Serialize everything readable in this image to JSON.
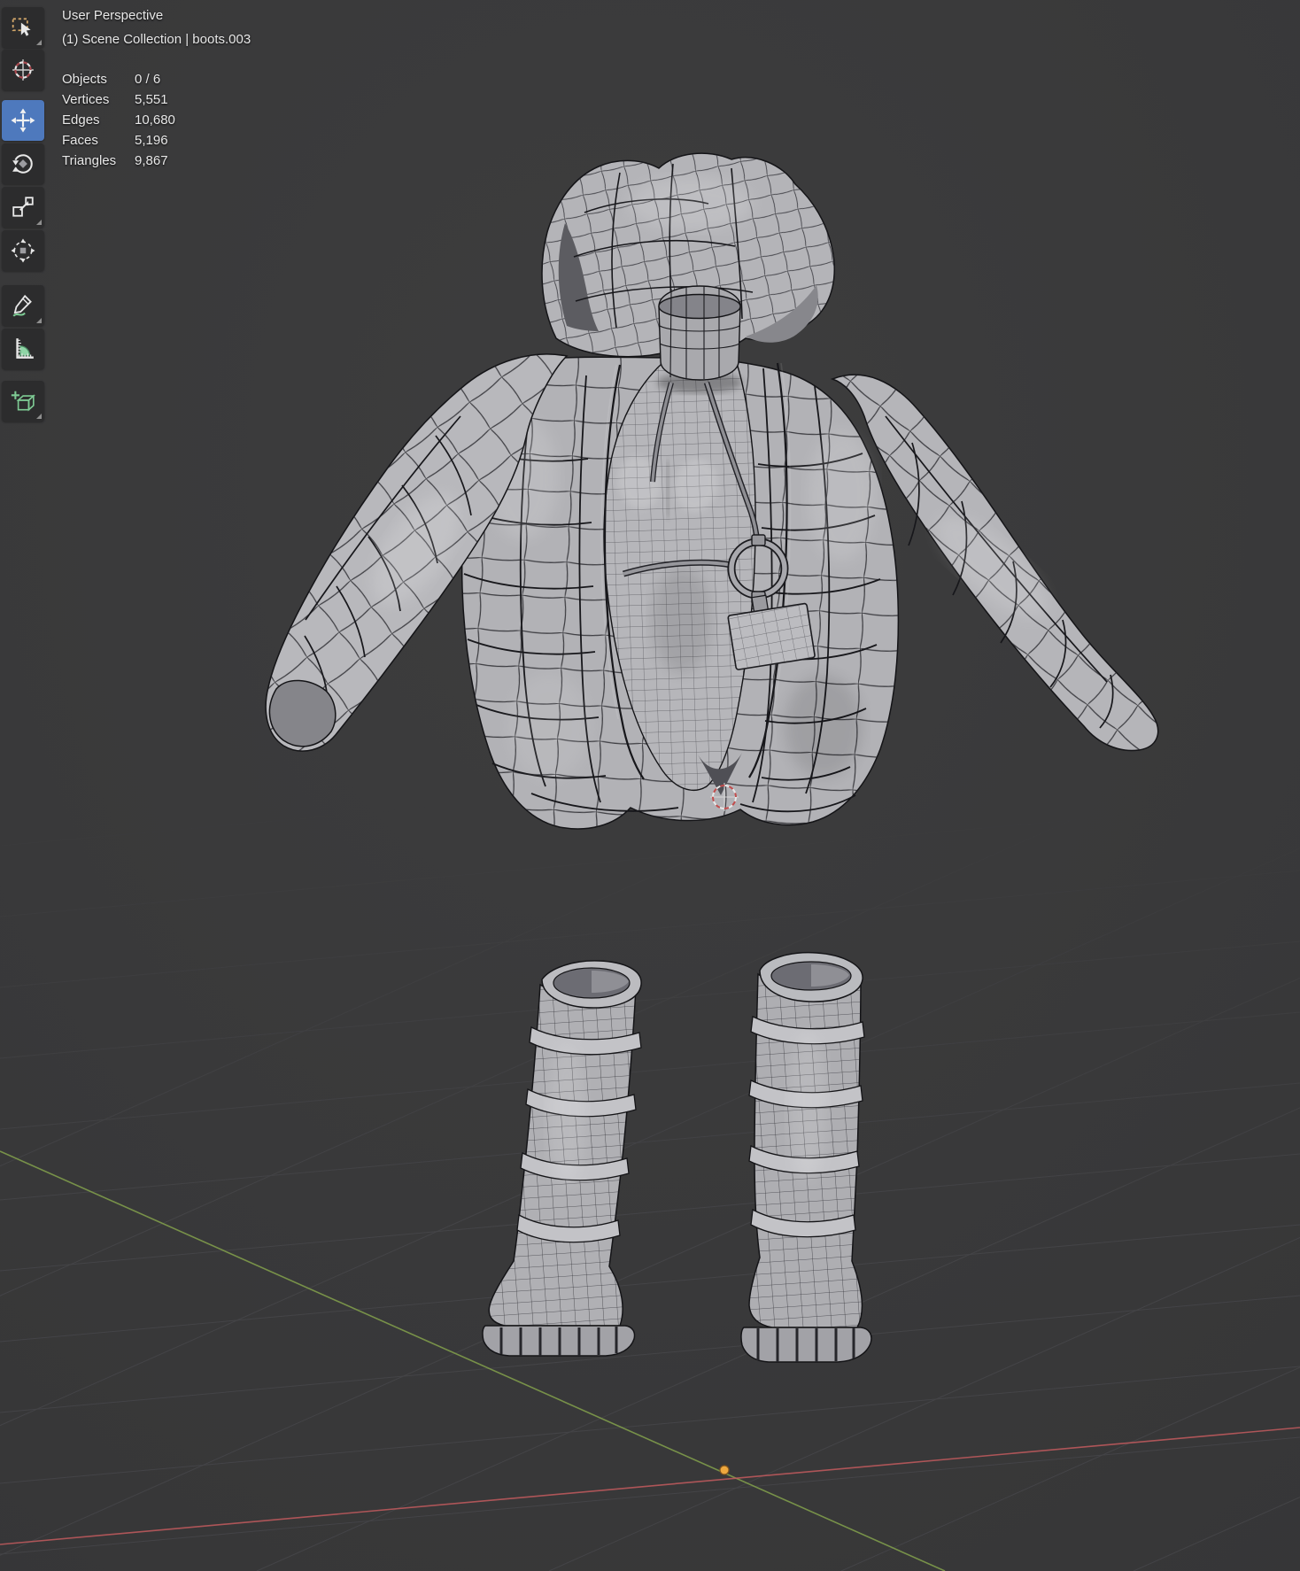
{
  "viewport": {
    "view_label": "User Perspective",
    "context_label": "(1) Scene Collection | boots.003",
    "stats": {
      "rows": [
        {
          "label": "Objects",
          "value": "0 / 6"
        },
        {
          "label": "Vertices",
          "value": "5,551"
        },
        {
          "label": "Edges",
          "value": "10,680"
        },
        {
          "label": "Faces",
          "value": "5,196"
        },
        {
          "label": "Triangles",
          "value": "9,867"
        }
      ]
    }
  },
  "toolbar": {
    "active_tool": "move",
    "tools": [
      {
        "id": "select-box",
        "has_submenu": true
      },
      {
        "id": "cursor",
        "has_submenu": false
      },
      {
        "id": "move",
        "has_submenu": false
      },
      {
        "id": "rotate",
        "has_submenu": false
      },
      {
        "id": "scale",
        "has_submenu": true
      },
      {
        "id": "transform",
        "has_submenu": false
      },
      {
        "id": "annotate",
        "has_submenu": true
      },
      {
        "id": "measure",
        "has_submenu": false
      },
      {
        "id": "add-cube",
        "has_submenu": true
      }
    ]
  },
  "colors": {
    "accent_blue": "#4e79bd",
    "axis_x_red": "#c35b5e",
    "axis_y_green": "#83a14c",
    "origin_orange": "#eea83e",
    "cursor_red": "#c24d4d",
    "tool_green": "#7ecb94",
    "tool_orange": "#cfa468",
    "background": "#3a3a3b"
  },
  "scene": {
    "visible_objects": [
      "hooded puffer jacket",
      "bodysuit with lanyard ring and badge",
      "pair of strapped platform boots"
    ]
  }
}
